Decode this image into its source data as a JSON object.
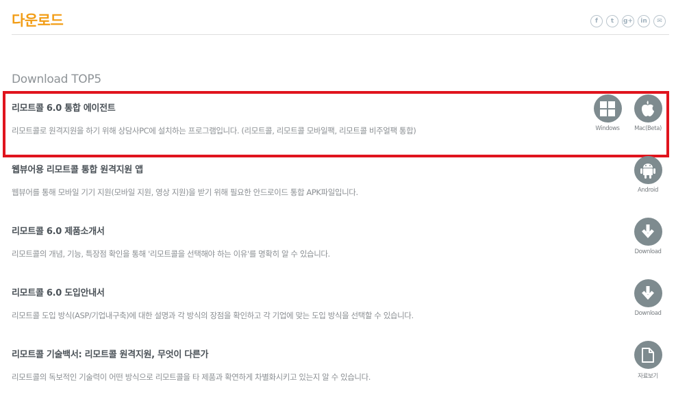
{
  "page": {
    "title": "다운로드",
    "social": [
      {
        "name": "facebook-icon",
        "glyph": "f"
      },
      {
        "name": "twitter-icon",
        "glyph": "t"
      },
      {
        "name": "googleplus-icon",
        "glyph": "g+"
      },
      {
        "name": "linkedin-icon",
        "glyph": "in"
      },
      {
        "name": "mail-icon",
        "glyph": "✉"
      }
    ]
  },
  "section": {
    "heading": "Download TOP5"
  },
  "items": [
    {
      "title": "리모트콜 6.0 통합 에이전트",
      "desc": "리모트콜로 원격지원을 하기 위해 상담사PC에 설치하는 프로그램입니다. (리모트콜, 리모트콜 모바일팩, 리모트콜 비주얼팩 통합)",
      "buttons": [
        {
          "label": "Windows",
          "icon": "windows-icon"
        },
        {
          "label": "Mac(Beta)",
          "icon": "apple-icon"
        }
      ]
    },
    {
      "title": "웹뷰어용 리모트콜 통합 원격지원 앱",
      "desc": "웹뷰어를 통해 모바일 기기 지원(모바일 지원, 영상 지원)을 받기 위해 필요한 안드로이드 통합 APK파일입니다.",
      "buttons": [
        {
          "label": "Android",
          "icon": "android-icon"
        }
      ]
    },
    {
      "title": "리모트콜 6.0 제품소개서",
      "desc": "리모트콜의 개념, 기능, 특장점 확인을 통해 '리모트콜을 선택해야 하는 이유'를 명확히 알 수 있습니다.",
      "buttons": [
        {
          "label": "Download",
          "icon": "download-arrow-icon"
        }
      ]
    },
    {
      "title": "리모트콜 6.0 도입안내서",
      "desc": "리모트콜 도입 방식(ASP/기업내구축)에 대한 설명과 각 방식의 장점을 확인하고 각 기업에 맞는 도입 방식을 선택할 수 있습니다.",
      "buttons": [
        {
          "label": "Download",
          "icon": "download-arrow-icon"
        }
      ]
    },
    {
      "title": "리모트콜 기술백서: 리모트콜 원격지원, 무엇이 다른가",
      "desc": "리모트콜의 독보적인 기술력이 어떤 방식으로 리모트콜을 타 제품과 확연하게 차별화시키고 있는지 알 수 있습니다.",
      "buttons": [
        {
          "label": "자료보기",
          "icon": "document-icon"
        }
      ]
    }
  ]
}
